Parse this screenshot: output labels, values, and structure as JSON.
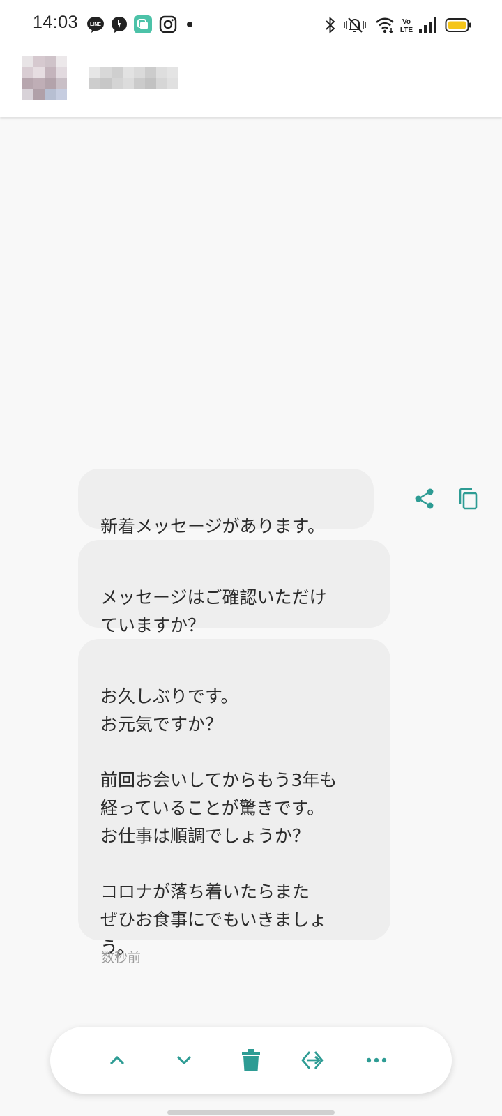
{
  "status_bar": {
    "time": "14:03",
    "notification_icons": [
      "line-icon",
      "messenger-icon",
      "green-app-icon",
      "instagram-icon",
      "dot-icon"
    ],
    "right_icons": [
      "bluetooth-icon",
      "mute-icon",
      "wifi-icon",
      "volte-icon",
      "signal-icon",
      "battery-icon"
    ],
    "battery_color": "#f5c518"
  },
  "header": {
    "avatar": "blurred-avatar",
    "contact_name": "blurred-name"
  },
  "messages": [
    {
      "text": "新着メッセージがあります。"
    },
    {
      "text": "メッセージはご確認いただけ\nていますか？"
    },
    {
      "text": "お久しぶりです。\nお元気ですか？\n\n前回お会いしてからもう3年も\n経っていることが驚きです。\nお仕事は順調でしょうか？\n\nコロナが落ち着いたらまた\nぜひお食事にでもいきましょ\nう。"
    }
  ],
  "message_actions": [
    "share-icon",
    "copy-icon"
  ],
  "timestamp": "数秒前",
  "toolbar": {
    "buttons": [
      "chevron-up-icon",
      "chevron-down-icon",
      "trash-icon",
      "exit-icon",
      "more-icon"
    ]
  },
  "colors": {
    "accent": "#2e9c94",
    "bubble": "#eeeeee",
    "background": "#f8f8f8"
  }
}
